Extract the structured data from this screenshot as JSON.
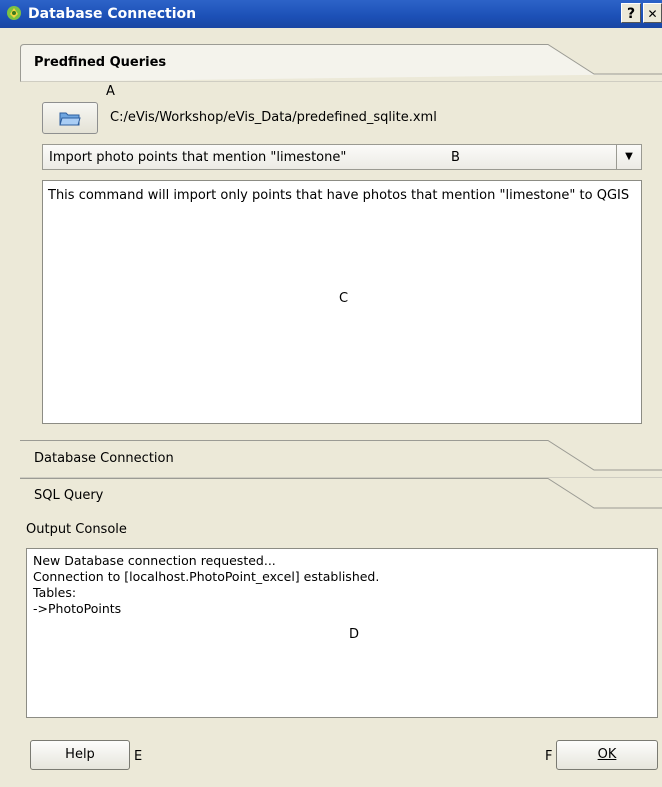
{
  "window": {
    "title": "Database Connection",
    "help_button": "?",
    "close_button": "✕"
  },
  "predefined": {
    "tab_label": "Predfined Queries",
    "annotation_a": "A",
    "file_path": "C:/eVis/Workshop/eVis_Data/predefined_sqlite.xml",
    "query_selected": "Import photo points that mention \"limestone\"",
    "annotation_b": "B",
    "description": "This command will import only points that have photos that mention \"limestone\" to QGIS",
    "annotation_c": "C"
  },
  "tabs": {
    "database_connection": "Database Connection",
    "sql_query": "SQL Query"
  },
  "output": {
    "label": "Output Console",
    "lines": [
      "New Database connection requested...",
      "Connection to [localhost.PhotoPoint_excel] established.",
      "Tables:",
      "->PhotoPoints"
    ],
    "annotation_d": "D"
  },
  "buttons": {
    "help": "Help",
    "annotation_e": "E",
    "annotation_f": "F",
    "ok": "OK"
  }
}
